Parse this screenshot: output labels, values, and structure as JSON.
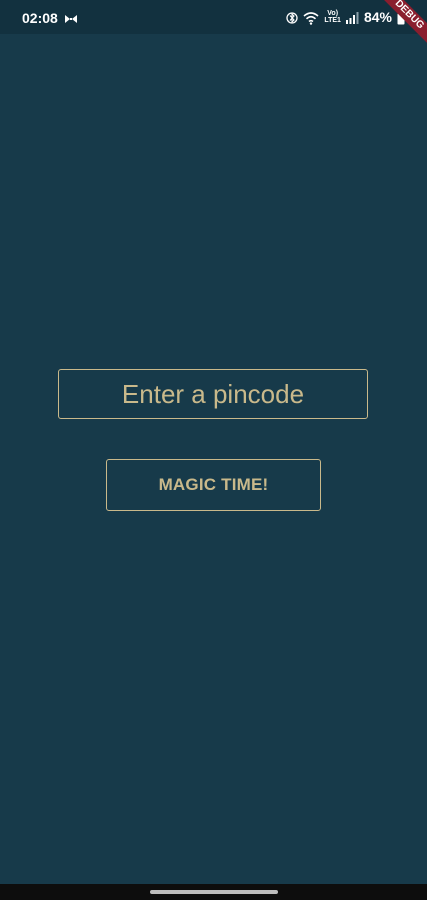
{
  "status_bar": {
    "time": "02:08",
    "battery_percent": "84%",
    "lte_label_top": "Vo)",
    "lte_label_bottom": "LTE1",
    "icons": [
      "notification-icon",
      "bluetooth-icon",
      "wifi-icon",
      "signal-icon",
      "battery-icon"
    ]
  },
  "debug_banner": {
    "label": "DEBUG"
  },
  "pincode": {
    "placeholder": "Enter a pincode",
    "value": ""
  },
  "magic_button": {
    "label": "MAGIC TIME!"
  },
  "colors": {
    "background": "#173a4a",
    "status_bar": "#12313f",
    "accent": "#c9b98b",
    "debug_ribbon": "#8a1e2e"
  }
}
